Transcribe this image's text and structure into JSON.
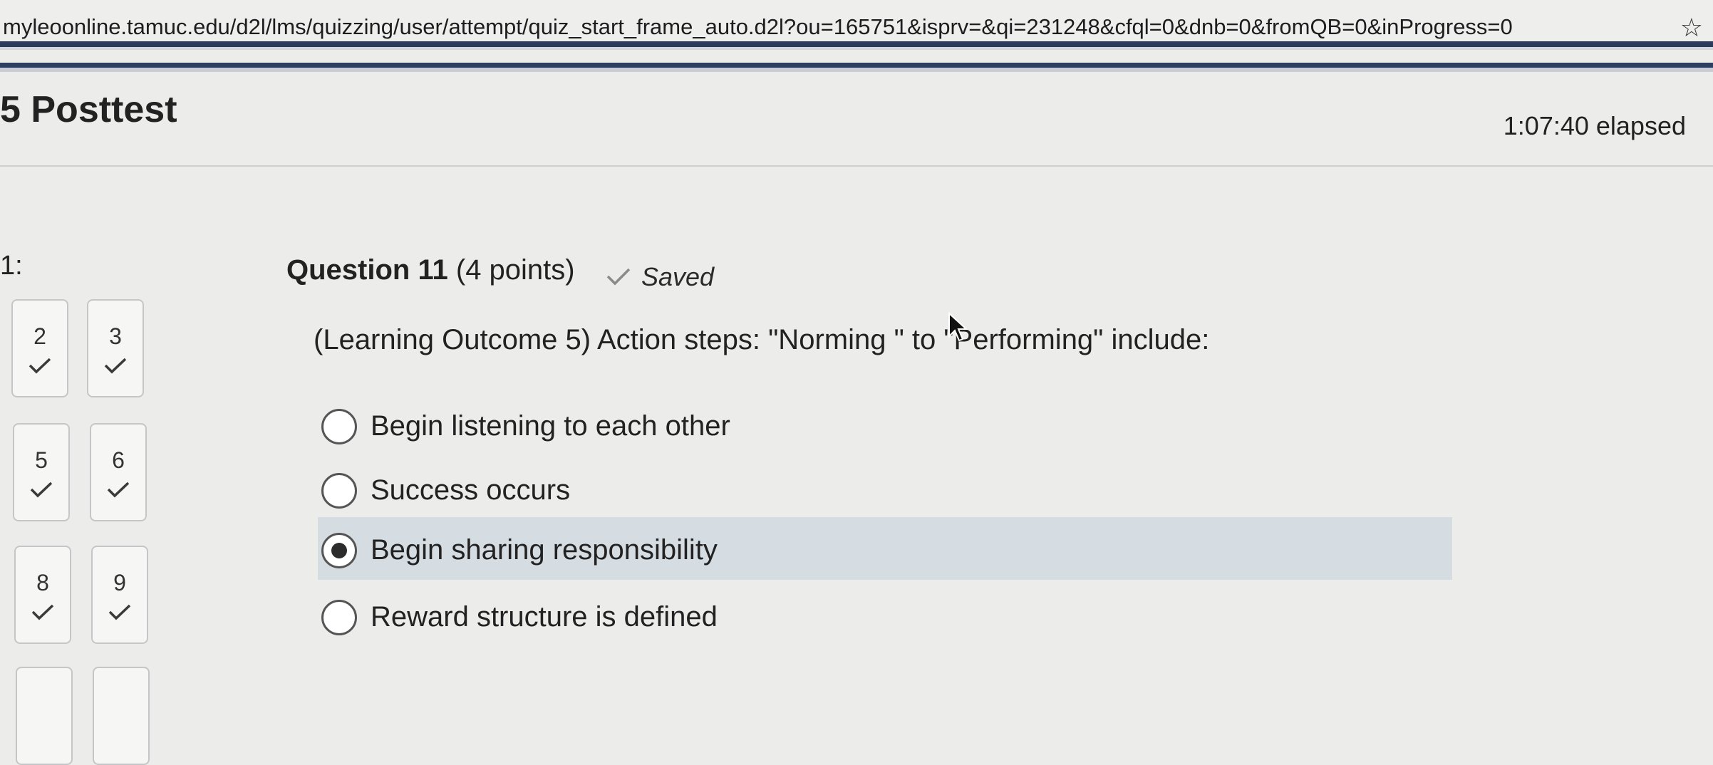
{
  "browser": {
    "url": "myleoonline.tamuc.edu/d2l/lms/quizzing/user/attempt/quiz_start_frame_auto.d2l?ou=165751&isprv=&qi=231248&cfql=0&dnb=0&fromQB=0&inProgress=0",
    "bookmark_icon": "star-icon"
  },
  "quiz": {
    "title": "5 Posttest",
    "elapsed": "1:07:40 elapsed"
  },
  "sidebar": {
    "label": "1:",
    "questions": [
      {
        "number": "2",
        "answered": true
      },
      {
        "number": "3",
        "answered": true
      },
      {
        "number": "5",
        "answered": true
      },
      {
        "number": "6",
        "answered": true
      },
      {
        "number": "8",
        "answered": true
      },
      {
        "number": "9",
        "answered": true
      }
    ]
  },
  "question": {
    "title": "Question 11",
    "points": "(4 points)",
    "status": "Saved",
    "text": "(Learning Outcome 5) Action steps: \"Norming \" to \"Performing\" include:",
    "options": [
      {
        "label": "Begin listening to each other",
        "selected": false
      },
      {
        "label": "Success occurs",
        "selected": false
      },
      {
        "label": "Begin sharing responsibility",
        "selected": true
      },
      {
        "label": "Reward structure is defined",
        "selected": false
      }
    ]
  },
  "colors": {
    "selected_option_bg": "#d5dce2",
    "header_bar": "#2a3b5c",
    "page_bg": "#ececeb"
  }
}
